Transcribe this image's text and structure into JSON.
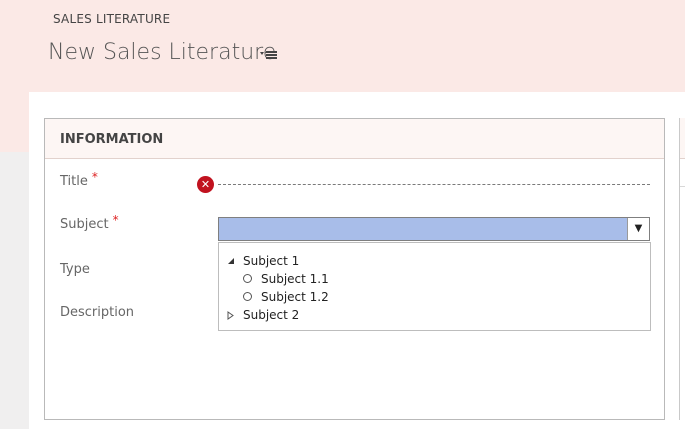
{
  "header": {
    "entity_label": "SALES LITERATURE",
    "record_title": "New Sales Literature"
  },
  "section": {
    "title": "INFORMATION"
  },
  "fields": {
    "title": {
      "label": "Title",
      "required_marker": "*"
    },
    "subject": {
      "label": "Subject",
      "required_marker": "*"
    },
    "type": {
      "label": "Type"
    },
    "description": {
      "label": "Description"
    }
  },
  "subject_tree": {
    "items": [
      {
        "label": "Subject 1",
        "expanded": true
      },
      {
        "label": "Subject 1.1"
      },
      {
        "label": "Subject 1.2"
      },
      {
        "label": "Subject 2",
        "expanded": false
      }
    ]
  },
  "icons": {
    "error": "error-icon",
    "dropdown": "chevron-down-icon",
    "menu": "menu-icon"
  },
  "colors": {
    "header_bg": "#fbe9e6",
    "lookup_highlight": "#a8bde9",
    "error": "#c1121f",
    "required": "#dd2222"
  }
}
